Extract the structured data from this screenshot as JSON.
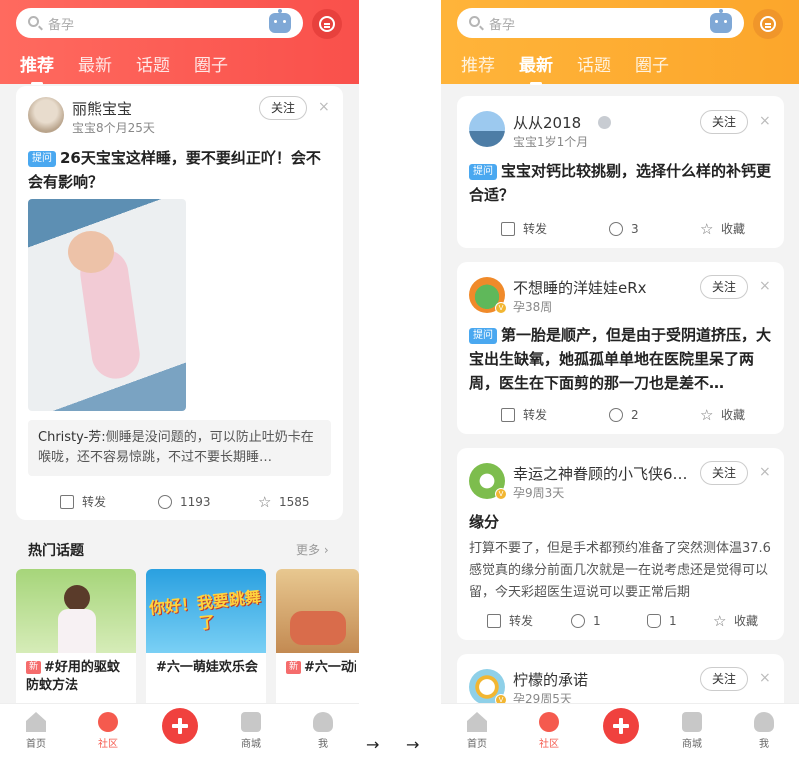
{
  "arrow_glyph": "→",
  "screens": {
    "left": {
      "search_placeholder": "备孕",
      "tabs": [
        "推荐",
        "最新",
        "话题",
        "圈子"
      ],
      "active_tab": 0,
      "post": {
        "username": "丽熊宝宝",
        "meta": "宝宝8个月25天",
        "follow_label": "关注",
        "close_glyph": "×",
        "title": "26天宝宝这样睡，要不要纠正吖！会不会有影响？",
        "comment_user": "Christy-芳:",
        "comment_text": "侧睡是没问题的，可以防止吐奶卡在喉咙，还不容易惊跳，不过不要长期睡…",
        "share_label": "转发",
        "comment_count": "1193",
        "fav_count": "1585"
      },
      "hot_topics": {
        "title": "热门话题",
        "more": "更多 ›",
        "new_tag": "新",
        "items": [
          {
            "text": "#好用的驱蚊防蚊方法",
            "new": true
          },
          {
            "text": "#六一萌娃欢乐会",
            "new": false
          },
          {
            "text": "#六一动画赏",
            "new": true
          }
        ],
        "topic2_art_text": "你好！我要跳舞了"
      }
    },
    "right": {
      "search_placeholder": "备孕",
      "tabs": [
        "推荐",
        "最新",
        "话题",
        "圈子"
      ],
      "active_tab": 1,
      "ask_tag": "提问",
      "follow_label": "关注",
      "close_glyph": "×",
      "share_label": "转发",
      "fav_label": "收藏",
      "posts": [
        {
          "username": "从从2018",
          "meta": "宝宝1岁1个月",
          "title": "宝宝对钙比较挑剔，选择什么样的补钙更合适？",
          "comments": "3"
        },
        {
          "username": "不想睡的洋娃娃eRx",
          "meta": "孕38周",
          "title": "第一胎是顺产，但是由于受阴道挤压，大宝出生缺氧，她孤孤单单地在医院里呆了两周，医生在下面剪的那一刀也是差不…",
          "comments": "2"
        },
        {
          "username": "幸运之神眷顾的小飞侠6…",
          "meta": "孕9周3天",
          "title": "缘分",
          "body": "打算不要了，但是手术都预约准备了突然测体温37.6感觉真的缘分前面几次就是一在说考虑还是觉得可以留，今天彩超医生逗说可以要正常后期",
          "comments": "1",
          "likes": "1"
        },
        {
          "username": "柠檬的承诺",
          "meta": "孕29周5天"
        }
      ]
    }
  },
  "bottom_nav": [
    "首页",
    "社区",
    "",
    "商城",
    "我"
  ],
  "colors": {
    "left_header": "#f9504b",
    "right_header": "#fca62b",
    "active_nav": "#f55a4e",
    "ask_tag": "#4aa8f0"
  }
}
